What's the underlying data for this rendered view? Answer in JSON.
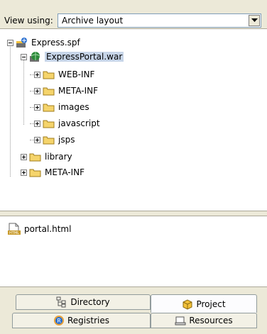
{
  "view_using": {
    "label": "View using:",
    "selected": "Archive layout"
  },
  "tree": {
    "root": "Express.spf",
    "war": "ExpressPortal.war",
    "war_children": [
      "WEB-INF",
      "META-INF",
      "images",
      "javascript",
      "jsps"
    ],
    "root_children": [
      "library",
      "META-INF"
    ]
  },
  "files": [
    {
      "name": "portal.html",
      "icon": "html-file-icon"
    }
  ],
  "tabs": {
    "directory": "Directory",
    "project": "Project",
    "registries": "Registries",
    "resources": "Resources"
  },
  "colors": {
    "selection": "#c7d5e8",
    "folder": "#f5d46b",
    "chrome": "#ece9d8"
  }
}
